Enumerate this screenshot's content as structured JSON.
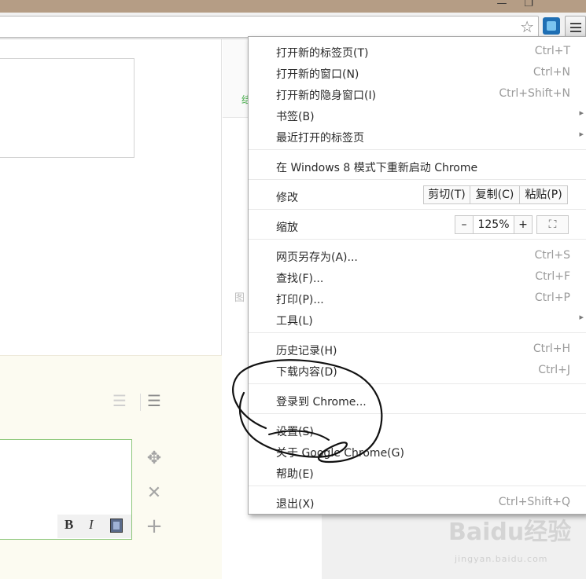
{
  "window": {
    "minimize_glyph": "—",
    "maximize_glyph": "❐"
  },
  "toolbar": {
    "star_glyph": "☆",
    "menu_button": "menu"
  },
  "editor": {
    "bold": "B",
    "italic": "I"
  },
  "page": {
    "side_label": "图",
    "green_mark": "结"
  },
  "watermark": {
    "main": "Baidu经验",
    "sub": "jingyan.baidu.com"
  },
  "menu": {
    "items": [
      {
        "label": "打开新的标签页(T)",
        "shortcut": "Ctrl+T"
      },
      {
        "label": "打开新的窗口(N)",
        "shortcut": "Ctrl+N"
      },
      {
        "label": "打开新的隐身窗口(I)",
        "shortcut": "Ctrl+Shift+N"
      },
      {
        "label": "书签(B)",
        "shortcut": "",
        "submenu": true
      },
      {
        "label": "最近打开的标签页",
        "shortcut": "",
        "submenu": true
      },
      {
        "label": "在 Windows 8 模式下重新启动 Chrome",
        "shortcut": ""
      },
      {
        "label": "修改"
      },
      {
        "label": "缩放"
      },
      {
        "label": "网页另存为(A)...",
        "shortcut": "Ctrl+S"
      },
      {
        "label": "查找(F)...",
        "shortcut": "Ctrl+F"
      },
      {
        "label": "打印(P)...",
        "shortcut": "Ctrl+P"
      },
      {
        "label": "工具(L)",
        "shortcut": "",
        "submenu": true
      },
      {
        "label": "历史记录(H)",
        "shortcut": "Ctrl+H"
      },
      {
        "label": "下载内容(D)",
        "shortcut": "Ctrl+J"
      },
      {
        "label": "登录到 Chrome...",
        "shortcut": ""
      },
      {
        "label": "设置(S)",
        "shortcut": ""
      },
      {
        "label": "关于 Google Chrome(G)",
        "shortcut": ""
      },
      {
        "label": "帮助(E)",
        "shortcut": ""
      },
      {
        "label": "退出(X)",
        "shortcut": "Ctrl+Shift+Q"
      }
    ],
    "edit": {
      "cut": "剪切(T)",
      "copy": "复制(C)",
      "paste": "粘贴(P)"
    },
    "zoom": {
      "minus": "–",
      "value": "125%",
      "plus": "+",
      "fullscreen": "⛶"
    },
    "submenu_arrow": "▸"
  },
  "colors": {
    "titlebar": "#b59d85",
    "menu_bg": "#ffffff",
    "shortcut": "#9a9a9a",
    "page_cream": "#fcfbf1",
    "editor_border": "#8cc77a"
  }
}
